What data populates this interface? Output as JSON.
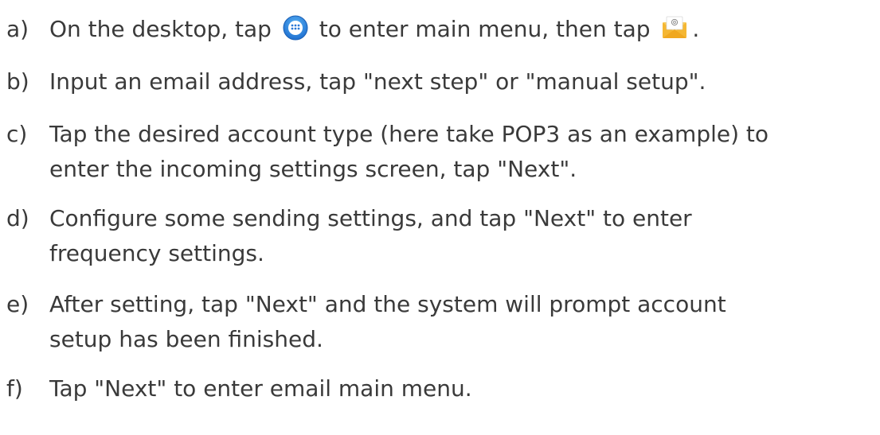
{
  "steps": [
    {
      "marker": "a)",
      "parts": [
        "On the desktop, tap",
        "to enter main menu, then tap",
        "."
      ],
      "icons": [
        "apps-menu-icon",
        "email-app-icon"
      ]
    },
    {
      "marker": "b)",
      "lines": [
        "Input an email address, tap \"next step\" or \"manual setup\"."
      ]
    },
    {
      "marker": "c)",
      "lines": [
        "Tap the desired account type (here take POP3 as an example) to",
        "enter the incoming settings screen, tap \"Next\"."
      ]
    },
    {
      "marker": "d)",
      "lines": [
        "Configure some sending settings, and tap \"Next\" to enter",
        "frequency settings."
      ]
    },
    {
      "marker": "e)",
      "lines": [
        "After setting, tap \"Next\" and the system will prompt account",
        "setup has been finished."
      ]
    },
    {
      "marker": "f)",
      "lines": [
        "Tap \"Next\" to enter email main menu."
      ]
    }
  ]
}
